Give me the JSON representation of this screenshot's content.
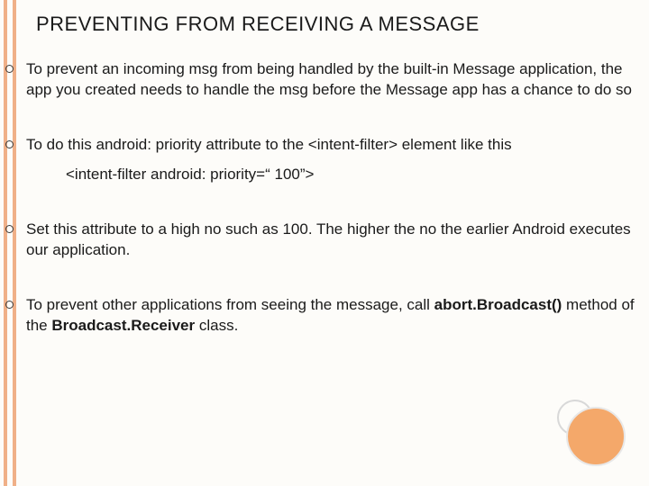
{
  "title": "PREVENTING FROM RECEIVING A MESSAGE",
  "bullets": [
    {
      "text": "To prevent an incoming msg from being handled by the built-in Message application, the app you created needs to handle the msg before the Message app has a chance to do so"
    },
    {
      "text": "To do this android: priority attribute to the <intent-filter> element  like this",
      "sub": "<intent-filter android: priority=“ 100”>"
    },
    {
      "text": "Set this attribute to a high no such as 100. The higher the no the earlier Android executes our application."
    },
    {
      "html": "To prevent other applications from seeing the message, call <b>abort.Broadcast()</b> method of the <b>Broadcast.Receiver</b> class."
    }
  ]
}
